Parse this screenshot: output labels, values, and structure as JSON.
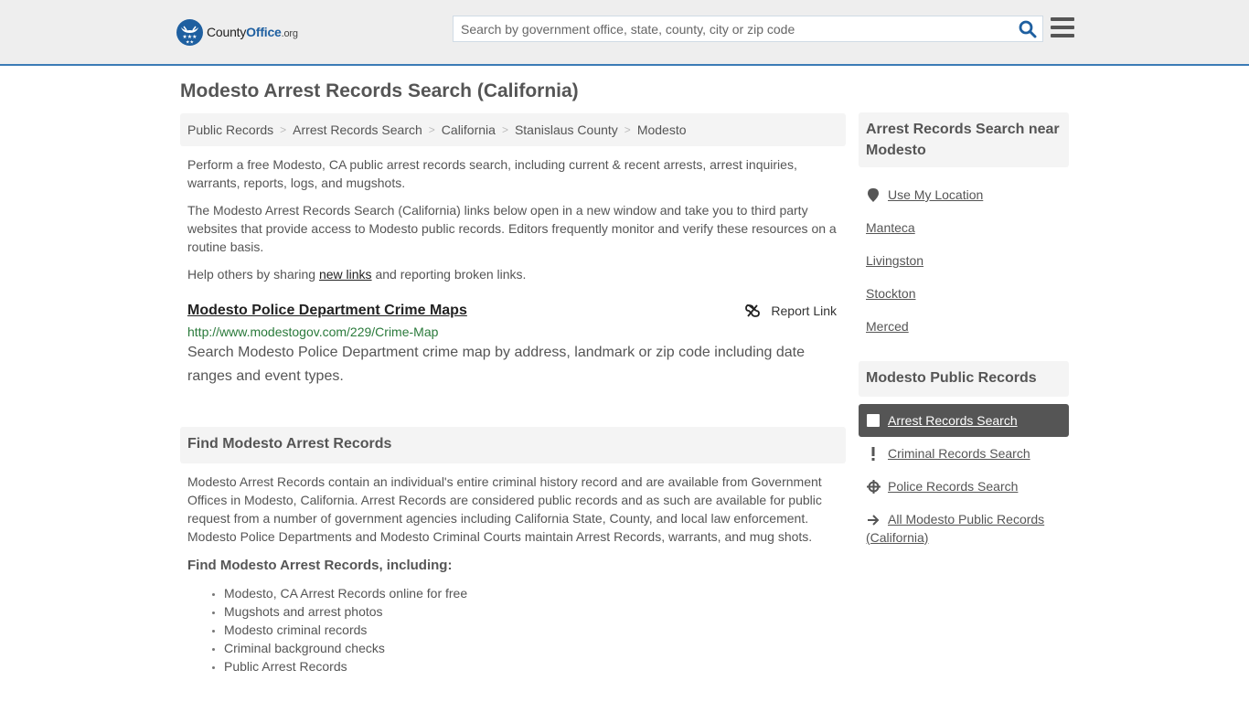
{
  "header": {
    "logo": {
      "name": "County",
      "accent": "Office",
      "tld": ".org"
    },
    "search": {
      "placeholder": "Search by government office, state, county, city or zip code",
      "value": ""
    },
    "icons": {
      "search": "search-icon",
      "menu": "hamburger-menu-icon"
    }
  },
  "page": {
    "title": "Modesto Arrest Records Search (California)"
  },
  "breadcrumb": [
    {
      "label": "Public Records"
    },
    {
      "label": "Arrest Records Search"
    },
    {
      "label": "California"
    },
    {
      "label": "Stanislaus County"
    },
    {
      "label": "Modesto"
    }
  ],
  "intro": {
    "p1": "Perform a free Modesto, CA public arrest records search, including current & recent arrests, arrest inquiries, warrants, reports, logs, and mugshots.",
    "p2": "The Modesto Arrest Records Search (California) links below open in a new window and take you to third party websites that provide access to Modesto public records. Editors frequently monitor and verify these resources on a routine basis.",
    "p3_before": "Help others by sharing ",
    "p3_link": "new links",
    "p3_after": " and reporting broken links."
  },
  "links": [
    {
      "title": "Modesto Police Department Crime Maps",
      "url": "http://www.modestogov.com/229/Crime-Map",
      "description": "Search Modesto Police Department crime map by address, landmark or zip code including date ranges and event types.",
      "report_label": "Report Link"
    }
  ],
  "find_section": {
    "heading": "Find Modesto Arrest Records",
    "body": "Modesto Arrest Records contain an individual's entire criminal history record and are available from Government Offices in Modesto, California. Arrest Records are considered public records and as such are available for public request from a number of government agencies including California State, County, and local law enforcement. Modesto Police Departments and Modesto Criminal Courts maintain Arrest Records, warrants, and mug shots.",
    "subheading": "Find Modesto Arrest Records, including:",
    "bullets": [
      "Modesto, CA Arrest Records online for free",
      "Mugshots and arrest photos",
      "Modesto criminal records",
      "Criminal background checks",
      "Public Arrest Records"
    ]
  },
  "sidebar": {
    "nearby": {
      "heading": "Arrest Records Search near Modesto",
      "use_location": "Use My Location",
      "cities": [
        "Manteca",
        "Livingston",
        "Stockton",
        "Merced"
      ]
    },
    "public_records": {
      "heading": "Modesto Public Records",
      "items": [
        {
          "label": "Arrest Records Search",
          "icon": "square-icon",
          "active": true
        },
        {
          "label": "Criminal Records Search",
          "icon": "exclamation-icon",
          "active": false
        },
        {
          "label": "Police Records Search",
          "icon": "crosshairs-icon",
          "active": false
        },
        {
          "label": "All Modesto Public Records (California)",
          "icon": "arrow-right-icon",
          "active": false
        }
      ]
    }
  },
  "colors": {
    "header_bg": "#eeeeee",
    "header_border": "#3b7bb6",
    "brand_blue": "#1e5fa0",
    "url_green": "#2a7a3b",
    "active_bg": "#555555",
    "panel_bg": "#f4f4f4"
  }
}
